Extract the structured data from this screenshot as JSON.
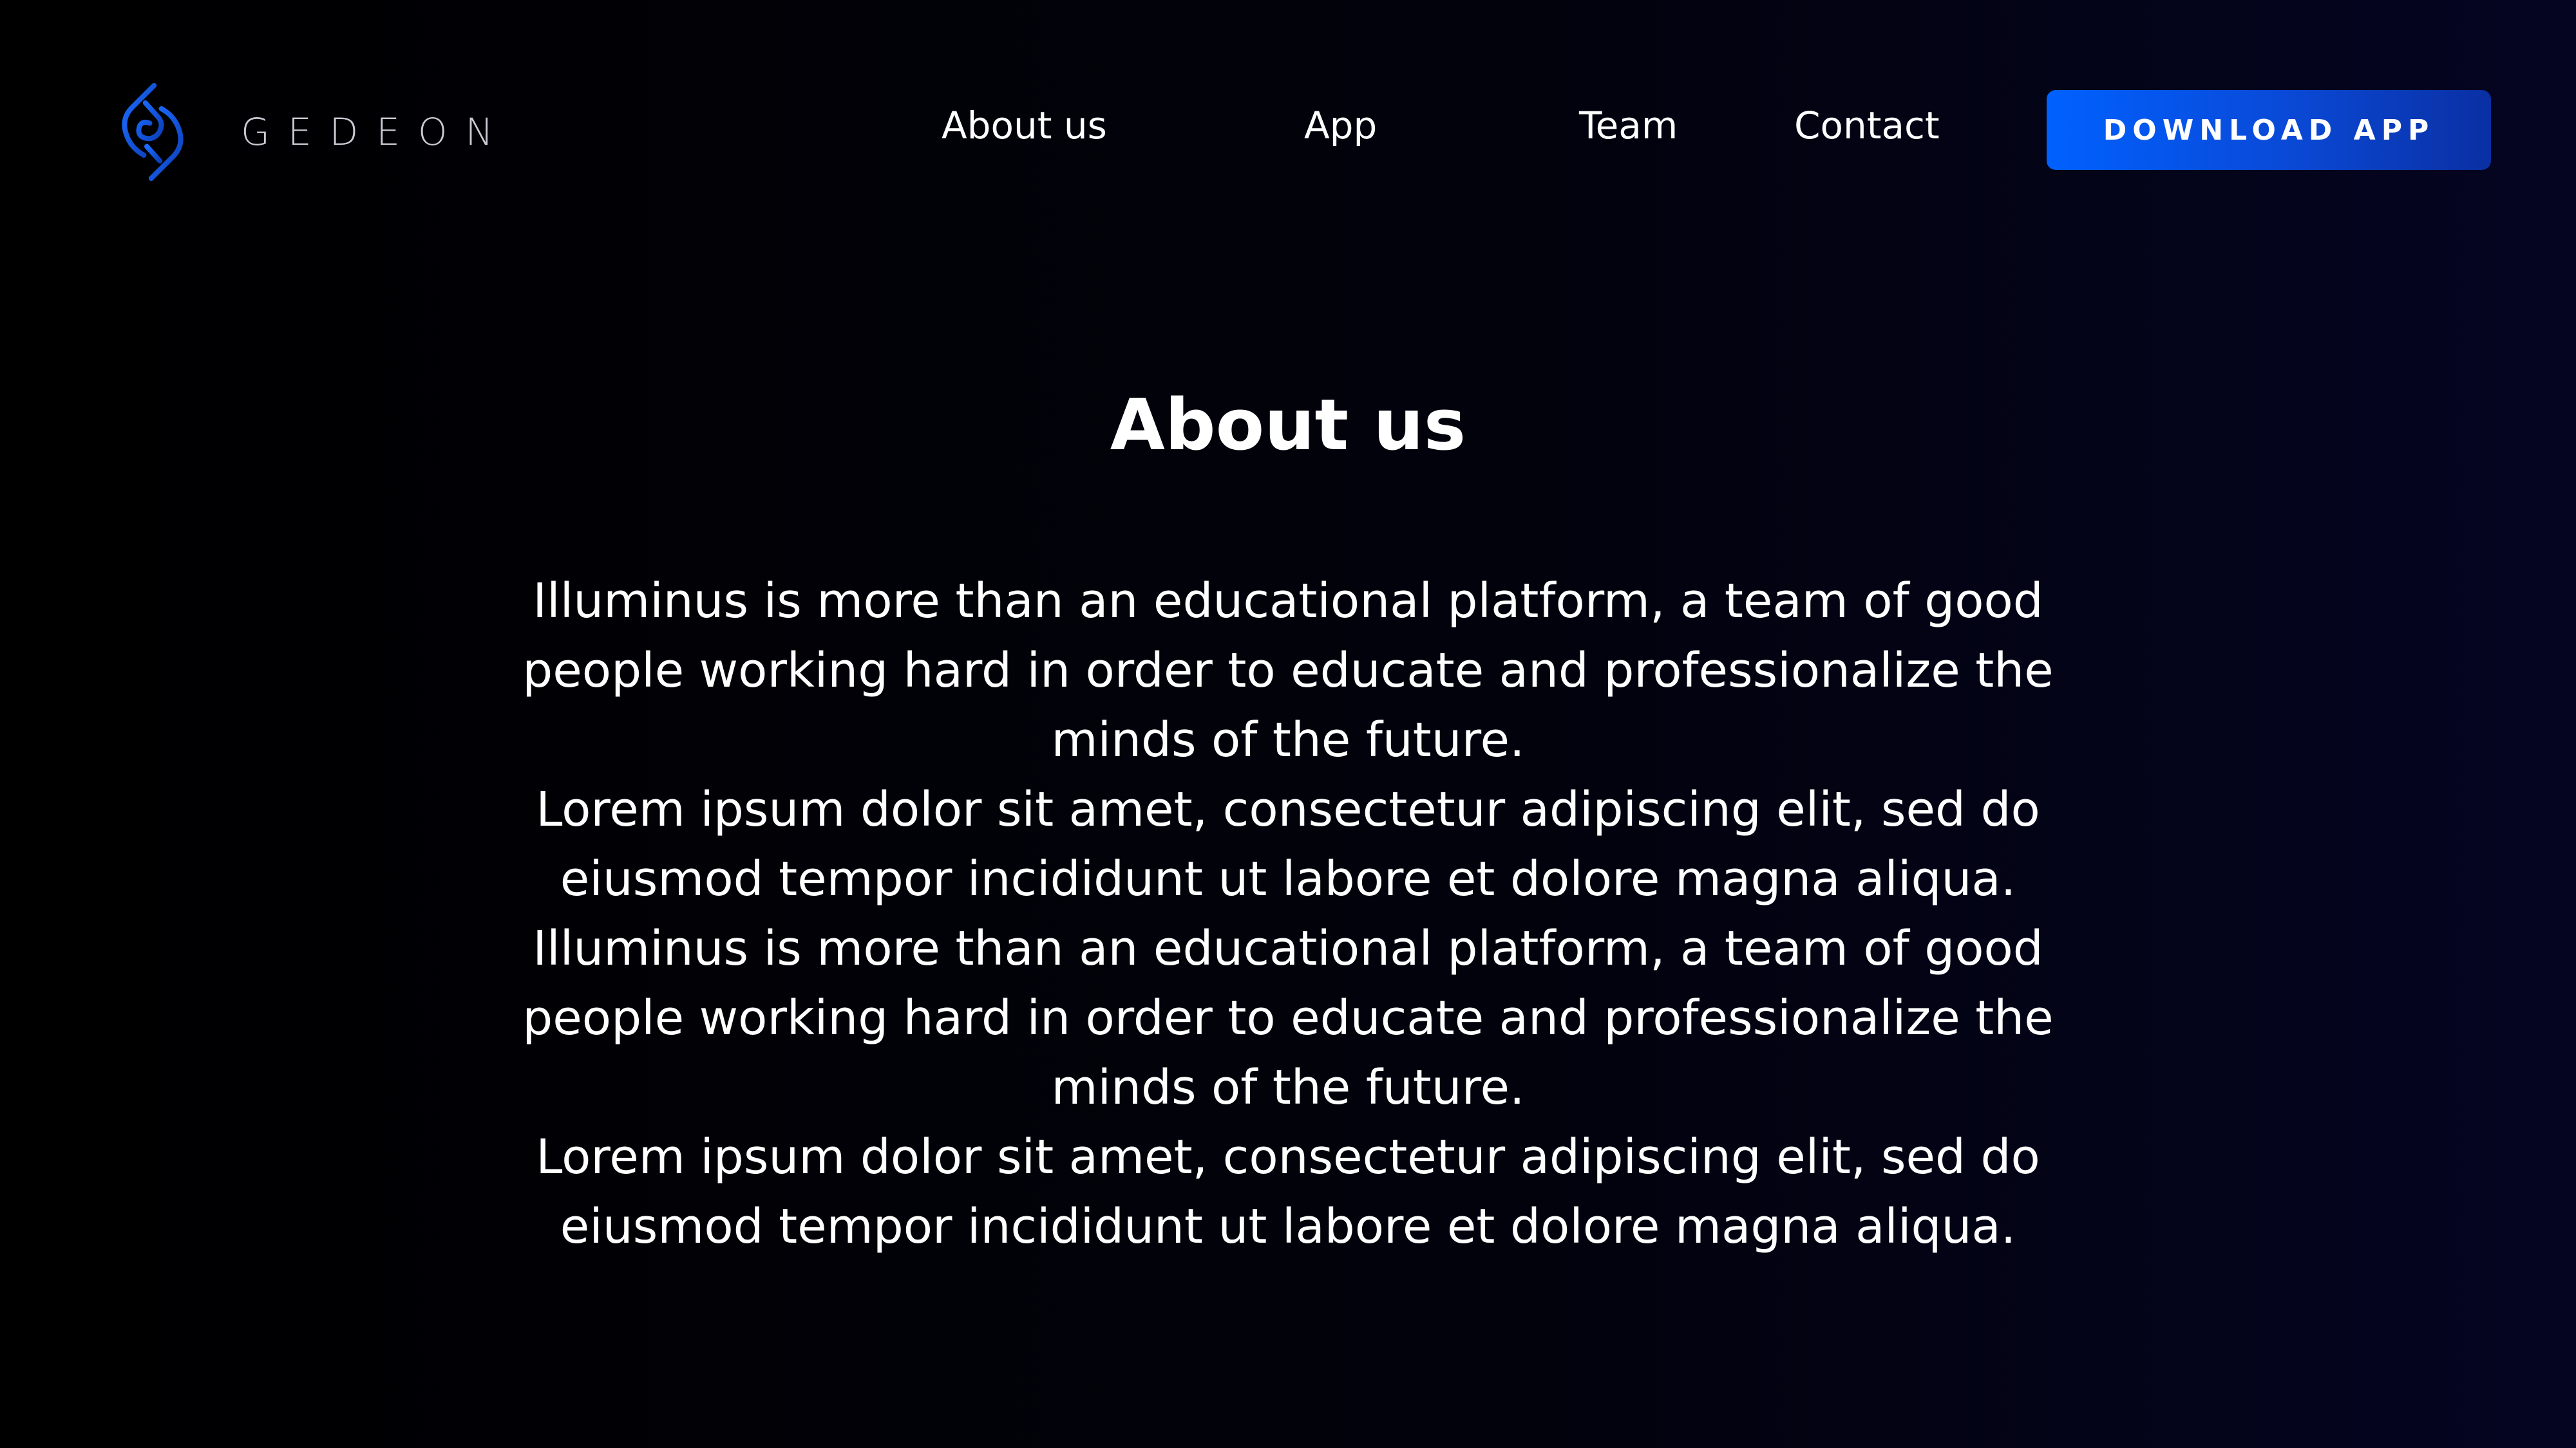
{
  "header": {
    "logo_text": "GEDEON",
    "nav": [
      {
        "label": "About us"
      },
      {
        "label": "App"
      },
      {
        "label": "Team"
      },
      {
        "label": "Contact"
      }
    ],
    "cta_label": "DOWNLOAD APP"
  },
  "main": {
    "title": "About us",
    "paragraphs": [
      "Illuminus is more than an educational platform, a team of good people working hard in order to educate and professionalize the minds of the future.",
      "Lorem ipsum dolor sit amet, consectetur adipiscing elit, sed do eiusmod tempor incididunt ut labore et dolore magna aliqua.",
      "Illuminus is more than an educational platform, a team of good people working hard in order to educate and professionalize the minds of the future.",
      "Lorem ipsum dolor sit amet, consectetur adipiscing elit, sed do eiusmod tempor incididunt ut labore et dolore magna aliqua."
    ]
  },
  "colors": {
    "background": "#000000",
    "accent": "#0a5cf5",
    "text": "#ffffff"
  },
  "icons": {
    "logo": "gedeon-logo-icon"
  }
}
